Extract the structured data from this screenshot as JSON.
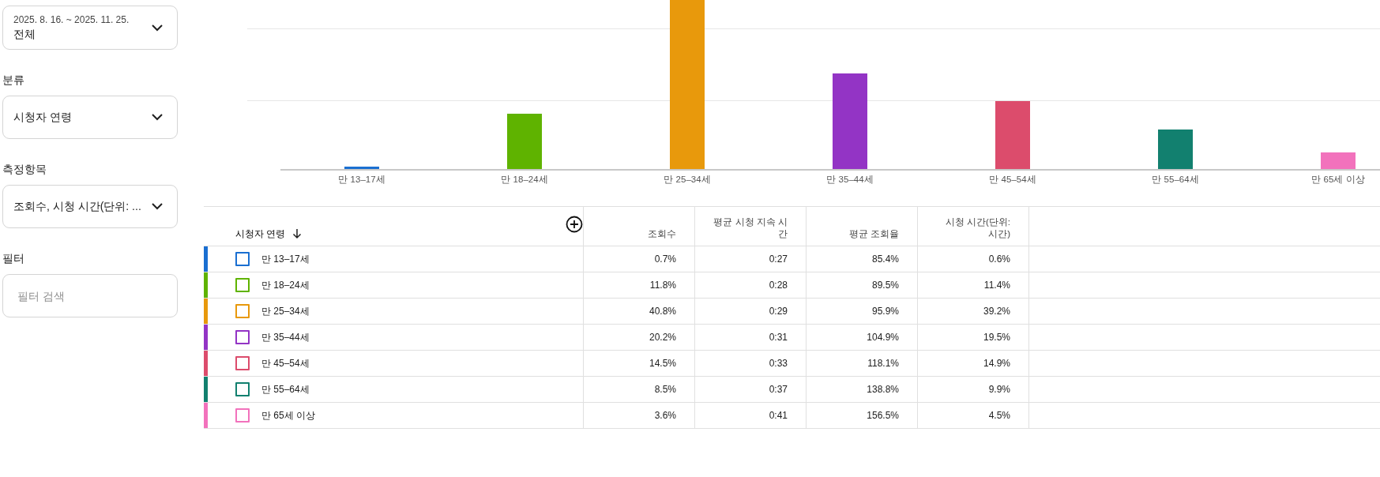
{
  "sidebar": {
    "date_range": {
      "range": "2025. 8. 16. ~ 2025. 11. 25.",
      "value": "전체"
    },
    "sections": [
      {
        "label": "분류",
        "kind": "dropdown",
        "value": "시청자 연령"
      },
      {
        "label": "측정항목",
        "kind": "dropdown",
        "value": "조회수, 시청 시간(단위: ..."
      },
      {
        "label": "필터",
        "kind": "search",
        "placeholder": "필터 검색"
      }
    ]
  },
  "chart": {
    "categories": [
      "만 13–17세",
      "만 18–24세",
      "만 25–34세",
      "만 35–44세",
      "만 45–54세",
      "만 55–64세",
      "만 65세 이상"
    ]
  },
  "table": {
    "columns": [
      {
        "label": "시청자 연령",
        "sorted": true
      },
      {
        "label": "조회수",
        "sorted": false
      },
      {
        "label": "평균 시청 지속 시간",
        "sorted": false
      },
      {
        "label": "평균 조회율",
        "sorted": false
      },
      {
        "label": "시청 시간(단위: 시간)",
        "sorted": false
      }
    ],
    "rows": [
      {
        "color": "#1a6fd1",
        "checked": false,
        "cells": [
          "만 13–17세",
          "0.7%",
          "0:27",
          "85.4%",
          "0.6%"
        ]
      },
      {
        "color": "#5fb300",
        "checked": false,
        "cells": [
          "만 18–24세",
          "11.8%",
          "0:28",
          "89.5%",
          "11.4%"
        ]
      },
      {
        "color": "#e8990c",
        "checked": false,
        "cells": [
          "만 25–34세",
          "40.8%",
          "0:29",
          "95.9%",
          "39.2%"
        ]
      },
      {
        "color": "#9334c5",
        "checked": false,
        "cells": [
          "만 35–44세",
          "20.2%",
          "0:31",
          "104.9%",
          "19.5%"
        ]
      },
      {
        "color": "#dc4c6c",
        "checked": false,
        "cells": [
          "만 45–54세",
          "14.5%",
          "0:33",
          "118.1%",
          "14.9%"
        ]
      },
      {
        "color": "#12806f",
        "checked": false,
        "cells": [
          "만 55–64세",
          "8.5%",
          "0:37",
          "138.8%",
          "9.9%"
        ]
      },
      {
        "color": "#f272bc",
        "checked": false,
        "cells": [
          "만 65세 이상",
          "3.6%",
          "0:41",
          "156.5%",
          "4.5%"
        ]
      }
    ]
  }
}
